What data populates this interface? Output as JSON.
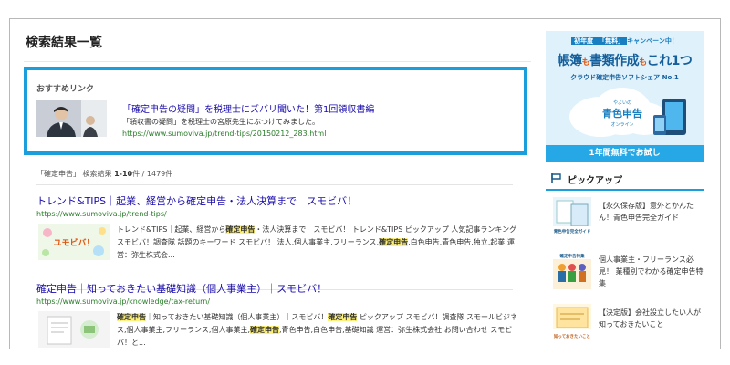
{
  "page": {
    "title": "検索結果一覧"
  },
  "recommended": {
    "label": "おすすめリンク",
    "title": "「確定申告の疑問」を税理士にズバリ聞いた！第1回領収書編",
    "desc": "「領収書の疑問」を税理士の宮原先生にぶつけてみました。",
    "url": "https://www.sumoviva.jp/trend-tips/20150212_283.html"
  },
  "results_summary": {
    "query": "「確定申告」",
    "label": "検索結果",
    "range": "1-10",
    "unit": "件",
    "total": "/ 1479件"
  },
  "results": [
    {
      "title": "トレンド&TIPS｜起業、経営から確定申告・法人決算まで　スモビバ！",
      "url": "https://www.sumoviva.jp/trend-tips/",
      "snippet": {
        "s1": "トレンド&TIPS｜起業、経営から",
        "h1": "確定申告",
        "s2": "・法人決算まで　スモビバ！ トレンド&TIPS ピックアップ 人気記事ランキング スモビバ！調査隊 話題のキーワード スモビバ！,法人,個人事業主,フリーランス,",
        "h2": "確定申告",
        "s3": ",白色申告,青色申告,独立,起業 運営：弥生株式会..."
      },
      "thumb_text": "ユモビバ！"
    },
    {
      "title": "確定申告｜知っておきたい基礎知識（個人事業主）｜スモビバ！",
      "url": "https://www.sumoviva.jp/knowledge/tax-return/",
      "snippet": {
        "h1": "確定申告",
        "s1": "｜知っておきたい基礎知識（個人事業主）｜スモビバ！",
        "h2": "確定申告",
        "s2": " ピックアップ スモビバ！調査隊 スモールビジネス,個人事業主,フリーランス,個人事業主,",
        "h3": "確定申告",
        "s3": ",青色申告,白色申告,基礎知識 運営：弥生株式会社 お問い合わせ スモビバ！と..."
      }
    }
  ],
  "ad": {
    "top_badge": "「無料」",
    "top_pre": "初年度",
    "top_post": "キャンペーン中！",
    "main_1": "帳簿",
    "main_mo1": "も",
    "main_2": "書類作成",
    "main_mo2": "も",
    "main_3": "これ1つ",
    "sub": "クラウド確定申告ソフトシェア No.1",
    "cloud_small": "やよいの",
    "cloud_label": "青色申告",
    "cloud_online": "オンライン",
    "bottom": "1年間無料でお試し"
  },
  "pickup": {
    "title": "ピックアップ",
    "items": [
      {
        "text": "【永久保存版】意外とかんたん！青色申告完全ガイド",
        "thumb": "青色申告完全ガイド"
      },
      {
        "text": "個人事業主・フリーランス必見！ 業種別でわかる確定申告特集",
        "thumb": "確定申告特集"
      },
      {
        "text": "【決定版】会社設立したい人が知っておきたいこと",
        "thumb": "知っておきたいこと"
      }
    ]
  },
  "colors": {
    "accent_blue": "#1a9fdc",
    "link": "#1a0dab",
    "url_green": "#2a7d2a",
    "highlight": "#fff27a"
  }
}
